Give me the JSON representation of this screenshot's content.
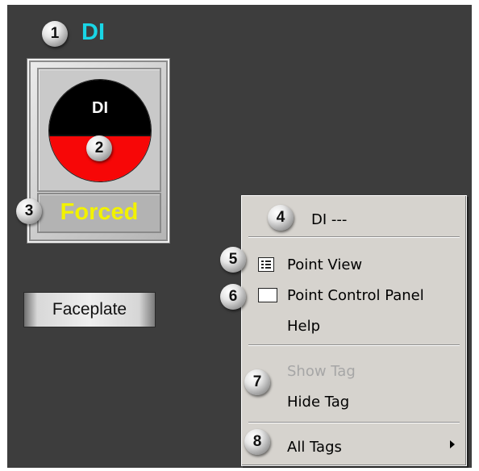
{
  "block": {
    "title": "DI",
    "indicator_label": "DI",
    "status": "Forced",
    "colors": {
      "title": "#19d6e6",
      "status": "#f2f200",
      "indicator_top": "#000000",
      "indicator_bottom": "#f70707"
    }
  },
  "faceplate_label": "Faceplate",
  "context_menu": {
    "header": "DI ---",
    "items": {
      "point_view": "Point View",
      "point_control_panel": "Point Control Panel",
      "help": "Help",
      "show_tag": "Show Tag",
      "hide_tag": "Hide Tag",
      "all_tags": "All Tags"
    },
    "disabled": [
      "Show Tag"
    ]
  },
  "callouts": [
    "1",
    "2",
    "3",
    "4",
    "5",
    "6",
    "7",
    "8"
  ],
  "icons": [
    "point-view-icon",
    "point-control-panel-icon",
    "submenu-arrow-icon"
  ]
}
